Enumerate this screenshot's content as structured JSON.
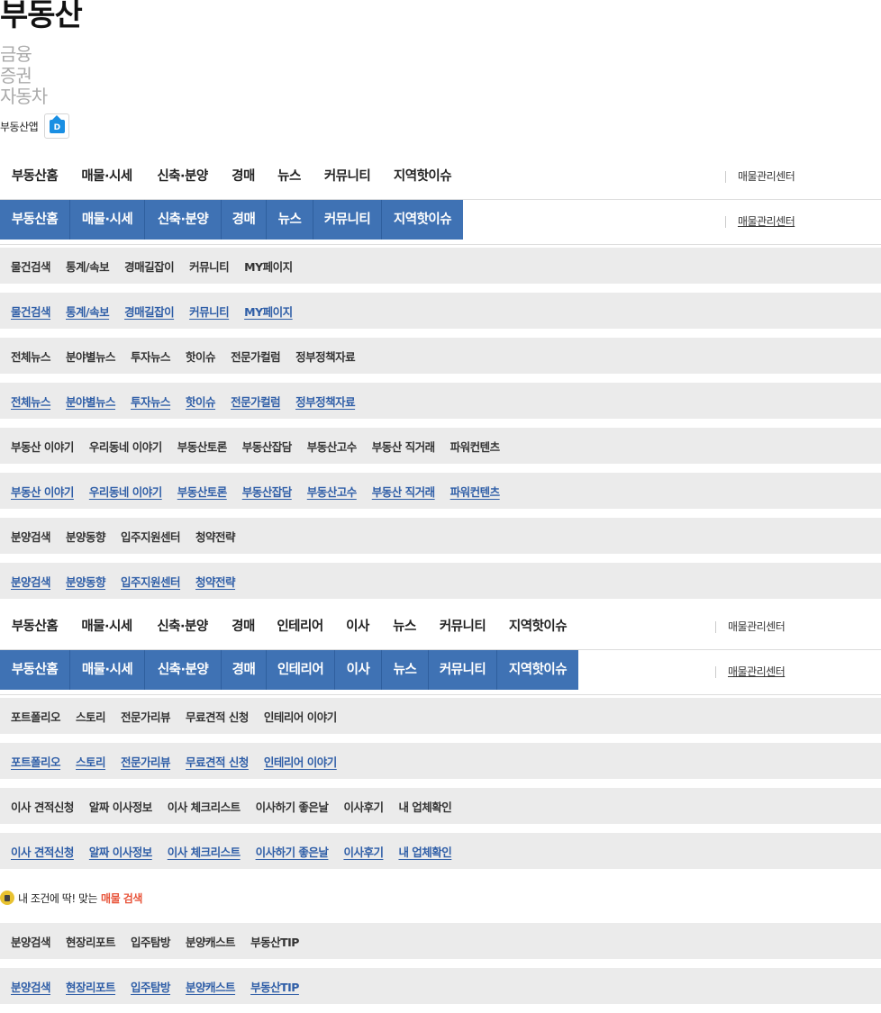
{
  "header": {
    "title": "부동산",
    "categories": [
      "금융",
      "증권",
      "자동차"
    ],
    "app_label": "부동산앱",
    "app_icon": "house-d-icon"
  },
  "gnb_main": {
    "items": [
      "부동산홈",
      "매물·시세",
      "신축·분양",
      "경매",
      "뉴스",
      "커뮤니티",
      "지역핫이슈"
    ],
    "manager_link": "매물관리센터"
  },
  "gnb_interior": {
    "items": [
      "부동산홈",
      "매물·시세",
      "신축·분양",
      "경매",
      "인테리어",
      "이사",
      "뉴스",
      "커뮤니티",
      "지역핫이슈"
    ],
    "manager_link": "매물관리센터"
  },
  "sub_auction": [
    "물건검색",
    "통계/속보",
    "경매길잡이",
    "커뮤니티",
    "MY페이지"
  ],
  "sub_news": [
    "전체뉴스",
    "분야별뉴스",
    "투자뉴스",
    "핫이슈",
    "전문가컬럼",
    "정부정책자료"
  ],
  "sub_community": [
    "부동산 이야기",
    "우리동네 이야기",
    "부동산토론",
    "부동산잡담",
    "부동산고수",
    "부동산 직거래",
    "파워컨텐츠"
  ],
  "sub_presale": [
    "분양검색",
    "분양동향",
    "입주지원센터",
    "청약전략"
  ],
  "sub_interior": [
    "포트폴리오",
    "스토리",
    "전문가리뷰",
    "무료견적 신청",
    "인테리어 이야기"
  ],
  "sub_moving": [
    "이사 견적신청",
    "알짜 이사정보",
    "이사 체크리스트",
    "이사하기 좋은날",
    "이사후기",
    "내 업체확인"
  ],
  "promo": {
    "text": "내 조건에 딱! 맞는",
    "highlight": "매물 검색",
    "highlight_color": "#e8543a"
  },
  "sub_newbuild": [
    "분양검색",
    "현장리포트",
    "입주탐방",
    "분양캐스트",
    "부동산TIP"
  ],
  "colors": {
    "active_tab": "#3f72b4",
    "sub_bar": "#ebebeb",
    "link": "#2f5ea7"
  }
}
